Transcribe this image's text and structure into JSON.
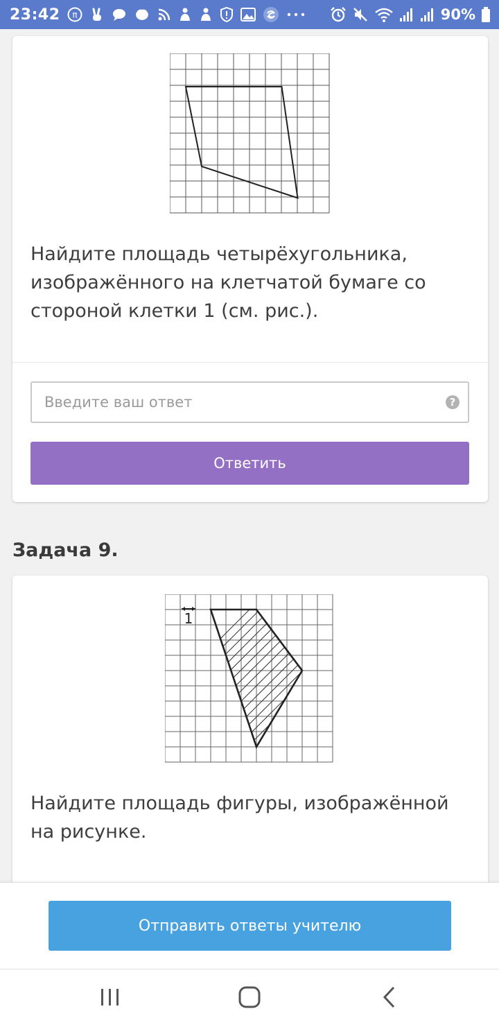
{
  "status_bar": {
    "time": "23:42",
    "battery_percent": "90%",
    "left_icons": [
      "pi-icon",
      "peace-hand-icon",
      "chat-bubble-icon",
      "hand-icon",
      "rss-icon",
      "person-icon",
      "person-icon",
      "shield-alert-icon",
      "image-icon",
      "swirl-icon",
      "more-dots-icon"
    ],
    "right_icons": [
      "alarm-icon",
      "mute-icon",
      "wifi-icon",
      "signal-icon",
      "signal-icon",
      "battery-icon"
    ],
    "background_color": "#5a7bcc"
  },
  "task8": {
    "text": "Найдите площадь четырёхугольника, изображённого на клетчатой бумаге со стороной клетки 1 (см. рис.).",
    "answer_placeholder": "Введите ваш ответ",
    "answer_value": "",
    "help_icon_label": "?",
    "submit_label": "Ответить",
    "submit_color": "#9370c4"
  },
  "task9": {
    "heading": "Задача 9.",
    "figure_unit_label": "1",
    "text": "Найдите площадь фигуры, изображённой на рисунке."
  },
  "bottom": {
    "send_label": "Отправить ответы учителю",
    "send_color": "#48a2e0"
  },
  "nav_bar": {
    "buttons": [
      "recent-apps-icon",
      "home-icon",
      "back-icon"
    ]
  }
}
